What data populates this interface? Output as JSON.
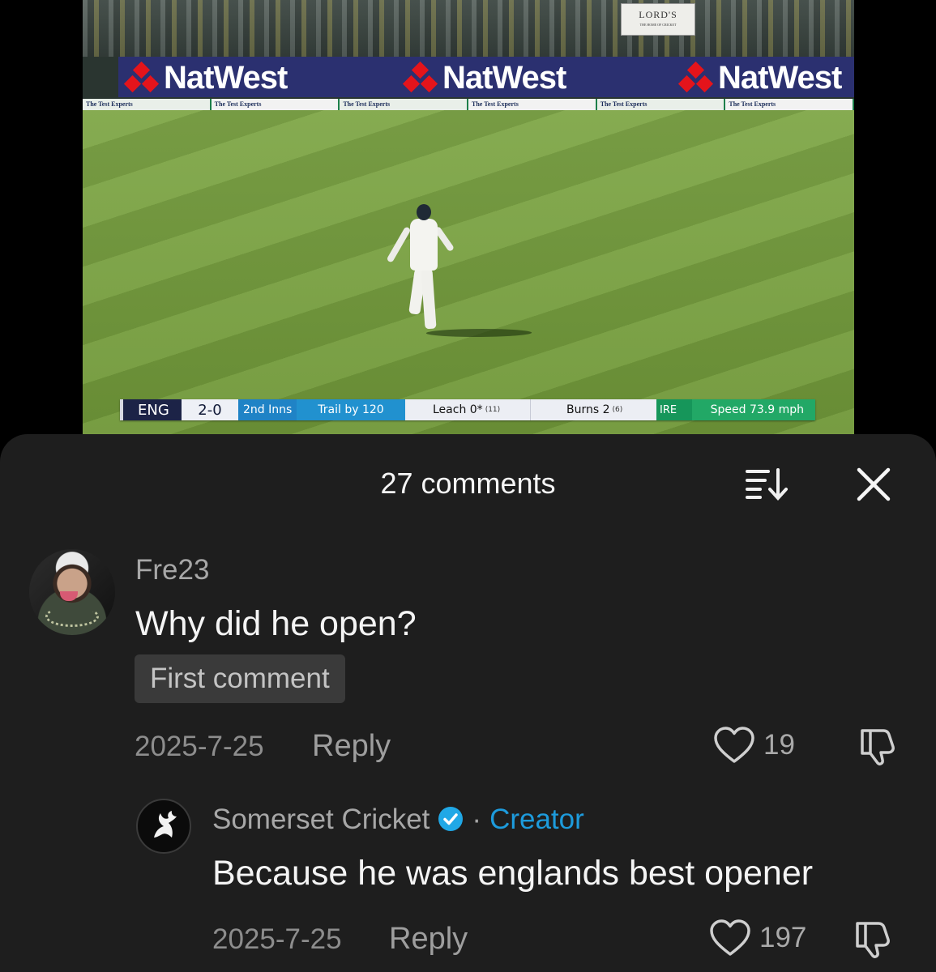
{
  "video": {
    "venue_sign": "LORD'S",
    "venue_sign_sub": "THE HOME OF CRICKET",
    "sponsor": "NatWest",
    "sponsor_strip": "The Test Experts",
    "scorebar": {
      "team": "ENG",
      "score": "2-0",
      "innings": "2nd Inns",
      "situation": "Trail by 120",
      "batter1_name": "Leach 0*",
      "batter1_balls": "(11)",
      "batter2_name": "Burns 2",
      "batter2_balls": "(6)",
      "opponent": "IRE",
      "speed": "Speed 73.9 mph"
    }
  },
  "sheet": {
    "title": "27 comments",
    "sort_icon": "sort-icon",
    "close_icon": "close-icon"
  },
  "comments": [
    {
      "username": "Fre23",
      "text": "Why did he open?",
      "badge": "First comment",
      "date": "2025-7-25",
      "reply_label": "Reply",
      "likes": "19"
    },
    {
      "username": "Somerset Cricket",
      "verified": true,
      "separator": "·",
      "role": "Creator",
      "text": "Because he was englands best opener",
      "date": "2025-7-25",
      "reply_label": "Reply",
      "likes": "197"
    }
  ],
  "colors": {
    "sheet_bg": "#1e1e1e",
    "creator_accent": "#1d9bdc",
    "verified_badge": "#20a8e6"
  }
}
